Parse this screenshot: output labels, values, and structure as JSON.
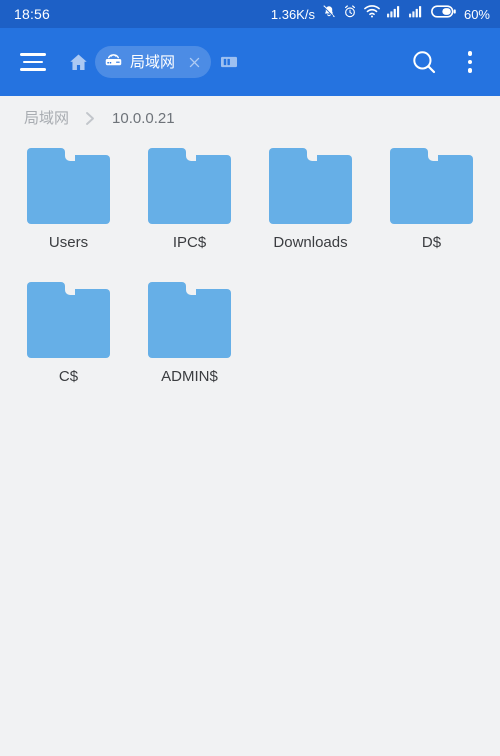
{
  "statusbar": {
    "clock": "18:56",
    "network_speed": "1.36K/s",
    "battery_percent": "60%",
    "icons": [
      "silent-bell-icon",
      "alarm-clock-icon",
      "wifi-icon",
      "signal-bars-icon",
      "signal-bars-icon",
      "battery-icon"
    ]
  },
  "toolbar": {
    "menu_icon": "hamburger-menu-icon",
    "home_icon": "home-icon",
    "tab_chip": {
      "icon": "router-icon",
      "label": "局域网",
      "close_icon": "close-icon"
    },
    "tabs_icon": "tabs-icon",
    "search_icon": "search-icon",
    "overflow_icon": "overflow-menu-icon"
  },
  "breadcrumb": {
    "separator": "›",
    "items": [
      {
        "label": "局域网",
        "current": false
      },
      {
        "label": "10.0.0.21",
        "current": true
      }
    ]
  },
  "files": {
    "items": [
      {
        "name": "Users",
        "type": "folder"
      },
      {
        "name": "IPC$",
        "type": "folder"
      },
      {
        "name": "Downloads",
        "type": "folder"
      },
      {
        "name": "D$",
        "type": "folder"
      },
      {
        "name": "C$",
        "type": "folder"
      },
      {
        "name": "ADMIN$",
        "type": "folder"
      }
    ]
  },
  "colors": {
    "statusbar_bg": "#1d60c6",
    "toolbar_bg": "#2573e0",
    "page_bg": "#f1f2f3",
    "folder_blue": "#66afe7",
    "label_text": "#3b3d40",
    "breadcrumb_text": "#a8acb1",
    "breadcrumb_current": "#6e7379"
  }
}
